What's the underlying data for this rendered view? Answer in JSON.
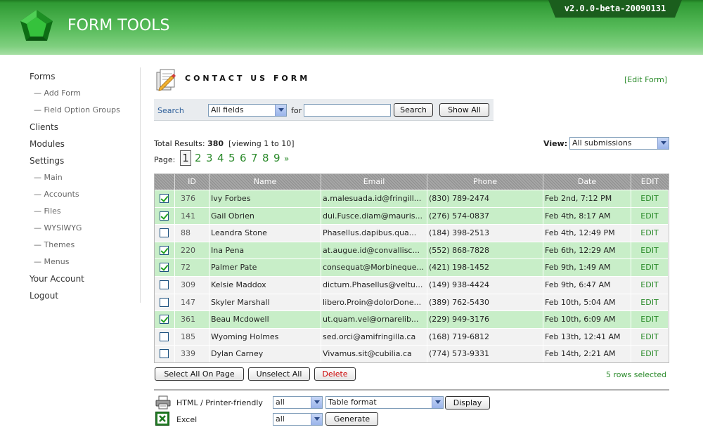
{
  "header": {
    "app_title": "FORM TOOLS",
    "version": "v2.0.0-beta-20090131"
  },
  "colors": {
    "brand_green": "#2f9a33",
    "link_green": "#2a8a2a",
    "selected_row": "#c8eec8",
    "unselected_row": "#f2f2f2"
  },
  "sidebar": {
    "items": [
      {
        "label": "Forms",
        "level": 0
      },
      {
        "label": "— Add Form",
        "level": 1
      },
      {
        "label": "— Field Option Groups",
        "level": 1
      },
      {
        "label": "Clients",
        "level": 0
      },
      {
        "label": "Modules",
        "level": 0
      },
      {
        "label": "Settings",
        "level": 0
      },
      {
        "label": "— Main",
        "level": 1
      },
      {
        "label": "— Accounts",
        "level": 1
      },
      {
        "label": "— Files",
        "level": 1
      },
      {
        "label": "— WYSIWYG",
        "level": 1
      },
      {
        "label": "— Themes",
        "level": 1
      },
      {
        "label": "— Menus",
        "level": 1
      },
      {
        "label": "Your Account",
        "level": 0
      },
      {
        "label": "Logout",
        "level": 0
      }
    ]
  },
  "page": {
    "title": "CONTACT US FORM",
    "edit_form_link": "[Edit Form]"
  },
  "search": {
    "label": "Search",
    "field_select": "All fields",
    "for_label": "for",
    "query": "",
    "search_button": "Search",
    "show_all_button": "Show All"
  },
  "results": {
    "total_label": "Total Results:",
    "total": "380",
    "viewing": "[viewing 1 to 10]",
    "view_label": "View:",
    "view_select": "All submissions",
    "page_label": "Page:",
    "current_page": "1",
    "pages": [
      "2",
      "3",
      "4",
      "5",
      "6",
      "7",
      "8",
      "9"
    ],
    "next": "»"
  },
  "table": {
    "columns": [
      "ID",
      "Name",
      "Email",
      "Phone",
      "Date",
      "EDIT"
    ],
    "rows": [
      {
        "selected": true,
        "id": "376",
        "name": "Ivy Forbes",
        "email": "a.malesuada.id@fringill...",
        "phone": "(830) 789-2474",
        "date": "Feb 2nd, 7:12 PM",
        "edit": "EDIT"
      },
      {
        "selected": true,
        "id": "141",
        "name": "Gail Obrien",
        "email": "dui.Fusce.diam@mauris...",
        "phone": "(276) 574-0837",
        "date": "Feb 4th, 8:17 AM",
        "edit": "EDIT"
      },
      {
        "selected": false,
        "id": "88",
        "name": "Leandra Stone",
        "email": "Phasellus.dapibus.qua...",
        "phone": "(184) 398-2513",
        "date": "Feb 4th, 12:49 PM",
        "edit": "EDIT"
      },
      {
        "selected": true,
        "id": "220",
        "name": "Ina Pena",
        "email": "at.augue.id@convallisc...",
        "phone": "(552) 868-7828",
        "date": "Feb 6th, 12:29 AM",
        "edit": "EDIT"
      },
      {
        "selected": true,
        "id": "72",
        "name": "Palmer Pate",
        "email": "consequat@Morbineque...",
        "phone": "(421) 198-1452",
        "date": "Feb 9th, 1:49 AM",
        "edit": "EDIT"
      },
      {
        "selected": false,
        "id": "309",
        "name": "Kelsie Maddox",
        "email": "dictum.Phasellus@veltu...",
        "phone": "(149) 938-4424",
        "date": "Feb 9th, 6:47 AM",
        "edit": "EDIT"
      },
      {
        "selected": false,
        "id": "147",
        "name": "Skyler Marshall",
        "email": "libero.Proin@dolorDone...",
        "phone": "(389) 762-5430",
        "date": "Feb 10th, 5:04 AM",
        "edit": "EDIT"
      },
      {
        "selected": true,
        "id": "361",
        "name": "Beau Mcdowell",
        "email": "ut.quam.vel@ornarelib...",
        "phone": "(229) 949-3176",
        "date": "Feb 10th, 6:09 AM",
        "edit": "EDIT"
      },
      {
        "selected": false,
        "id": "185",
        "name": "Wyoming Holmes",
        "email": "sed.orci@amifringilla.ca",
        "phone": "(168) 719-6812",
        "date": "Feb 13th, 12:41 AM",
        "edit": "EDIT"
      },
      {
        "selected": false,
        "id": "339",
        "name": "Dylan Carney",
        "email": "Vivamus.sit@cubilia.ca",
        "phone": "(774) 573-9331",
        "date": "Feb 14th, 2:21 AM",
        "edit": "EDIT"
      }
    ]
  },
  "actions": {
    "select_all": "Select All On Page",
    "unselect_all": "Unselect All",
    "delete": "Delete",
    "rows_selected": "5 rows selected"
  },
  "export": {
    "html_label": "HTML / Printer-friendly",
    "html_scope": "all",
    "html_format": "Table format",
    "display_button": "Display",
    "excel_label": "Excel",
    "excel_scope": "all",
    "generate_button": "Generate"
  },
  "icons": {
    "logo": "green-gem-icon",
    "form": "form-edit-icon",
    "printer": "printer-icon",
    "excel": "excel-icon"
  }
}
